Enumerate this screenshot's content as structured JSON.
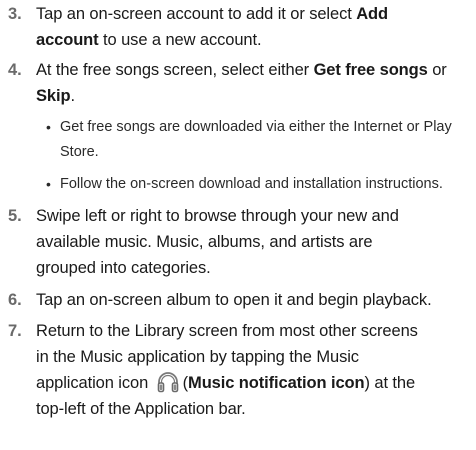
{
  "steps": [
    {
      "number": "3.",
      "line1_a": "Tap an on-screen account to add it or select ",
      "line1_b": "Add",
      "line2_a": "account",
      "line2_b": " to use a new account."
    },
    {
      "number": "4.",
      "line1_a": "At the free songs screen, select either ",
      "line1_b": "Get free songs",
      "line1_c": " or",
      "line2_a": "Skip",
      "line2_b": ".",
      "bullets": [
        {
          "line1": "Get free songs are downloaded via either the Internet or Play",
          "line2": "Store."
        },
        {
          "line1": "Follow the on-screen download and installation instructions."
        }
      ]
    },
    {
      "number": "5.",
      "line1": "Swipe left or right to browse through your new and",
      "line2": "available music. Music, albums, and artists are",
      "line3": "grouped into categories."
    },
    {
      "number": "6.",
      "line1": "Tap an on-screen album to open it and begin playback."
    },
    {
      "number": "7.",
      "line1": "Return to the Library screen from most other screens",
      "line2": "in the Music application by tapping the Music",
      "line3_a": "application icon ",
      "line3_b": "(",
      "line3_c": "Music notification icon",
      "line3_d": ") at the",
      "line4": "top-left of the Application bar."
    }
  ],
  "bullet_glyph": "•",
  "icons": {
    "music_app": "headphones-icon"
  }
}
